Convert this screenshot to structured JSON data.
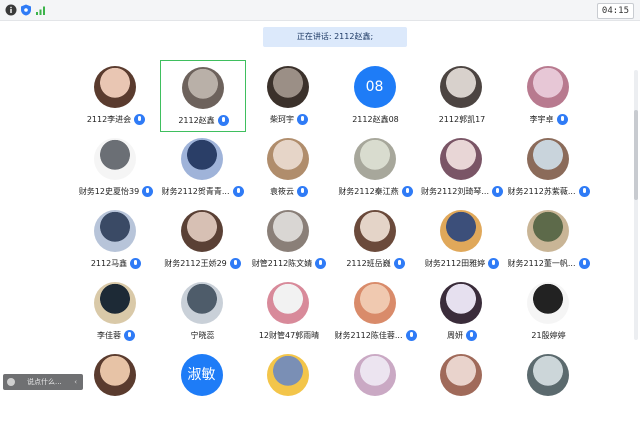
{
  "topbar": {
    "icons": [
      "info-icon",
      "shield-icon",
      "signal-icon"
    ],
    "timer": "04:15"
  },
  "speaker_banner": "正在讲话: 2112赵鑫;",
  "chat": {
    "placeholder": "说点什么..."
  },
  "colors": {
    "accent": "#1e7cf7",
    "active_border": "#3fbf5e"
  },
  "participants": [
    {
      "name": "2112李进会",
      "mic": true
    },
    {
      "name": "2112赵鑫",
      "mic": true,
      "active": true
    },
    {
      "name": "柴珂宇",
      "mic": true
    },
    {
      "name": "2112赵鑫08",
      "mic": false,
      "avatar_text": "08"
    },
    {
      "name": "2112郭凯17",
      "mic": false
    },
    {
      "name": "李宇卓",
      "mic": true
    },
    {
      "name": "财务12史夏怡39",
      "mic": true
    },
    {
      "name": "财务2112贺青青...",
      "mic": true
    },
    {
      "name": "袁筱云",
      "mic": true
    },
    {
      "name": "财务2112秦江燕",
      "mic": true
    },
    {
      "name": "财务2112刘琦琴...",
      "mic": true
    },
    {
      "name": "财务2112苏紫薇...",
      "mic": true
    },
    {
      "name": "2112马鑫",
      "mic": true
    },
    {
      "name": "财务2112王娇29",
      "mic": true
    },
    {
      "name": "财管2112陈文婧",
      "mic": true
    },
    {
      "name": "2112班岳巍",
      "mic": true
    },
    {
      "name": "财务2112田雅婷",
      "mic": true
    },
    {
      "name": "财务2112董一帆...",
      "mic": true
    },
    {
      "name": "李佳蓉",
      "mic": true
    },
    {
      "name": "宁晓蕊",
      "mic": false
    },
    {
      "name": "12财管47郭雨晴",
      "mic": false
    },
    {
      "name": "财务2112陈佳蓉...",
      "mic": true
    },
    {
      "name": "周妍",
      "mic": true
    },
    {
      "name": "21殷婷婷",
      "mic": false
    },
    {
      "name": "",
      "mic": false
    },
    {
      "name": "",
      "mic": false,
      "avatar_text": "淑敏"
    },
    {
      "name": "",
      "mic": false
    },
    {
      "name": "",
      "mic": false
    },
    {
      "name": "",
      "mic": false
    },
    {
      "name": "",
      "mic": false
    }
  ]
}
